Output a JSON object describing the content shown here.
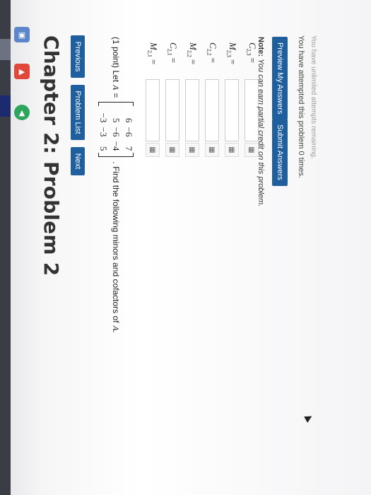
{
  "page": {
    "title": "Chapter 2: Problem 2"
  },
  "nav": {
    "previous": "Previous",
    "problem_list": "Problem List",
    "next": "Next"
  },
  "problem": {
    "points": "(1 point) Let",
    "matrix_name": "A",
    "equals": "=",
    "matrix": [
      [
        "6",
        "−6",
        "7"
      ],
      [
        "5",
        "−6",
        "−4"
      ],
      [
        "−3",
        "−3",
        "5"
      ]
    ],
    "instruction": ". Find the following minors and cofactors of",
    "instruction_end": "A."
  },
  "answers": [
    {
      "symbol": "M",
      "sub": "2,1",
      "eq": "=",
      "value": ""
    },
    {
      "symbol": "C",
      "sub": "2,1",
      "eq": "=",
      "value": ""
    },
    {
      "symbol": "M",
      "sub": "2,2",
      "eq": "=",
      "value": ""
    },
    {
      "symbol": "C",
      "sub": "2,2",
      "eq": "=",
      "value": ""
    },
    {
      "symbol": "M",
      "sub": "2,3",
      "eq": "=",
      "value": ""
    },
    {
      "symbol": "C",
      "sub": "2,3",
      "eq": "=",
      "value": ""
    }
  ],
  "note": {
    "label": "Note:",
    "text": "You can earn partial credit on this problem."
  },
  "actions": {
    "preview": "Preview My Answers",
    "submit": "Submit Answers"
  },
  "status": {
    "attempts": "You have attempted this problem 0 times.",
    "unlimited": "You have unlimited attempts remaining."
  },
  "colors": {
    "button_blue": "#1f5f9e",
    "strip_dark": "#3a3d45"
  }
}
